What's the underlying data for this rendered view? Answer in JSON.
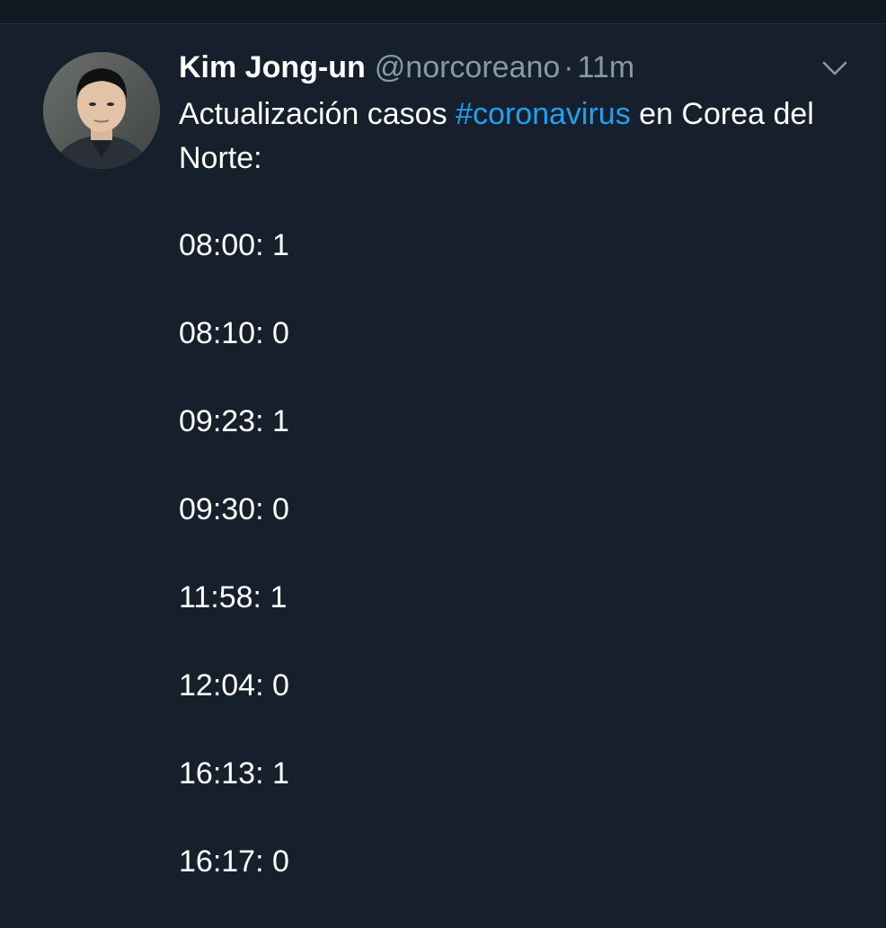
{
  "tweet": {
    "author_name": "Kim Jong-un",
    "handle": "@norcoreano",
    "separator": "·",
    "time": "11m",
    "text_before": "Actualización casos ",
    "hashtag": "#coronavirus",
    "text_after": " en Corea del Norte:",
    "entries": [
      "08:00: 1",
      "08:10: 0",
      "09:23: 1",
      "09:30: 0",
      "11:58: 1",
      "12:04: 0",
      "16:13: 1",
      "16:17: 0"
    ]
  },
  "icons": {
    "menu": "chevron-down-icon"
  },
  "colors": {
    "background": "#16202c",
    "top_bar": "#111923",
    "primary_text": "#ffffff",
    "secondary_text": "#8899a6",
    "link": "#1da1f2"
  }
}
